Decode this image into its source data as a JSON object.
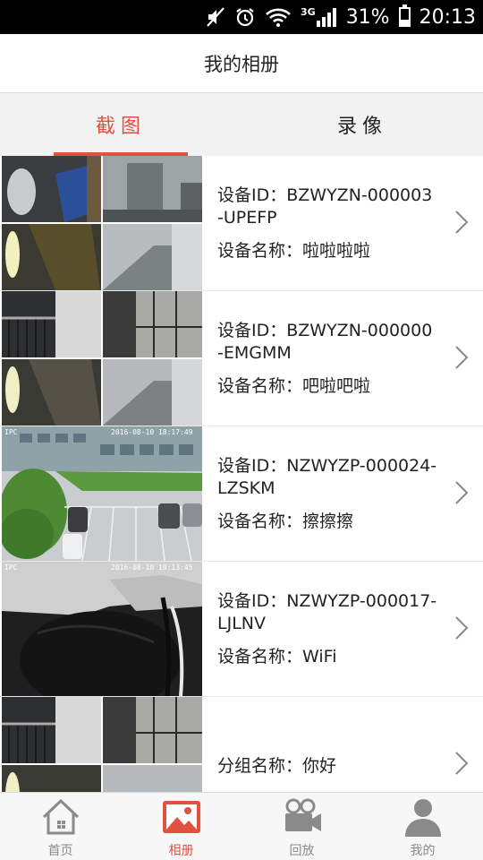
{
  "status_bar": {
    "network": "3G",
    "battery": "31%",
    "battery_level": 0.31,
    "time": "20:13"
  },
  "header": {
    "title": "我的相册"
  },
  "tabs": [
    {
      "label": "截图",
      "active": true
    },
    {
      "label": "录像",
      "active": false
    }
  ],
  "devices": [
    {
      "id_line": "设备ID：BZWYZN-000003-UPEFP",
      "name_line": "设备名称：啦啦啦啦"
    },
    {
      "id_line": "设备ID：BZWYZN-000000-EMGMM",
      "name_line": "设备名称：吧啦吧啦"
    },
    {
      "id_line": "设备ID：NZWYZP-000024-LZSKM",
      "name_line": "设备名称：擦擦擦"
    },
    {
      "id_line": "设备ID：NZWYZP-000017-LJLNV",
      "name_line": "设备名称：WiFi"
    },
    {
      "group_line": "分组名称：你好"
    }
  ],
  "thumb_overlays": {
    "row3": {
      "tag": "IPC",
      "timestamp": "2016-08-10  18:17:49"
    },
    "row4": {
      "tag": "IPC",
      "timestamp": "2016-08-10  19:13:45"
    }
  },
  "bottom_nav": [
    {
      "label": "首页",
      "icon": "home-icon",
      "active": false
    },
    {
      "label": "相册",
      "icon": "album-icon",
      "active": true
    },
    {
      "label": "回放",
      "icon": "video-camera-icon",
      "active": false
    },
    {
      "label": "我的",
      "icon": "person-icon",
      "active": false
    }
  ],
  "colors": {
    "accent": "#e0513f",
    "inactive": "#8a8a8a",
    "status_bar": "#000000"
  }
}
